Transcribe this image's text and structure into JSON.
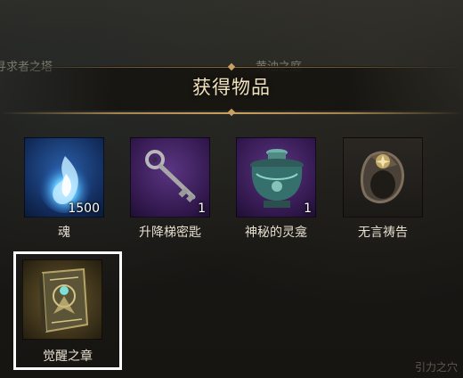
{
  "background": {
    "map_label_left": "寻求者之塔",
    "map_label_right": "黄油之庭",
    "corner_hint": "引力之穴"
  },
  "header": {
    "title": "获得物品"
  },
  "items": [
    {
      "name": "魂",
      "quantity": "1500",
      "icon": "blue-flame-soul-icon",
      "frame": "blue"
    },
    {
      "name": "升降梯密匙",
      "quantity": "1",
      "icon": "key-icon",
      "frame": "purple"
    },
    {
      "name": "神秘的灵龛",
      "quantity": "1",
      "icon": "urn-icon",
      "frame": "purple"
    },
    {
      "name": "无言祷告",
      "quantity": "",
      "icon": "ring-icon",
      "frame": "dark"
    },
    {
      "name": "觉醒之章",
      "quantity": "",
      "icon": "ornate-book-icon",
      "frame": "gold",
      "selected": true
    }
  ],
  "colors": {
    "title_gold": "#c9a262",
    "selection_border": "#ffffff"
  }
}
